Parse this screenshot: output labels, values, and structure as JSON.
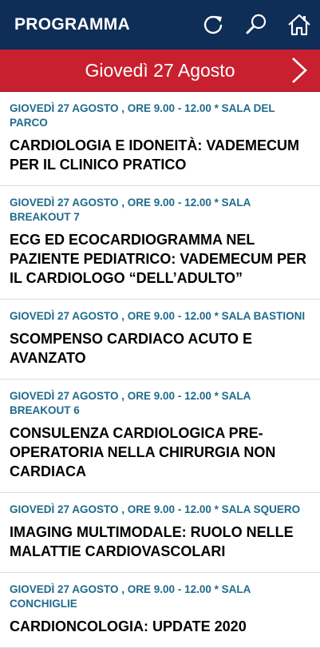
{
  "header": {
    "title": "PROGRAMMA",
    "icons": [
      "refresh-icon",
      "search-icon",
      "home-icon"
    ]
  },
  "datebar": {
    "label": "Giovedì 27 Agosto"
  },
  "colors": {
    "header_bg": "#0e2d57",
    "datebar_bg": "#c8202f",
    "meta_text": "#1e6a8d"
  },
  "sessions": [
    {
      "meta": "GIOVEDÌ 27 AGOSTO , ORE 9.00 - 12.00 * SALA DEL PARCO",
      "title": "CARDIOLOGIA E IDONEITÀ: VADEMECUM PER IL CLINICO PRATICO"
    },
    {
      "meta": "GIOVEDÌ 27 AGOSTO , ORE 9.00 - 12.00 * SALA BREAKOUT 7",
      "title": "ECG ED ECOCARDIOGRAMMA NEL PAZIENTE PEDIATRICO: VADEMECUM PER IL CARDIOLOGO “DELL’ADULTO”"
    },
    {
      "meta": "GIOVEDÌ 27 AGOSTO , ORE 9.00 - 12.00 * SALA BASTIONI",
      "title": "SCOMPENSO CARDIACO ACUTO E AVANZATO"
    },
    {
      "meta": "GIOVEDÌ 27 AGOSTO , ORE 9.00 - 12.00 * SALA BREAKOUT 6",
      "title": "CONSULENZA CARDIOLOGICA PRE-OPERATORIA NELLA CHIRURGIA NON CARDIACA"
    },
    {
      "meta": "GIOVEDÌ 27 AGOSTO , ORE 9.00 - 12.00 * SALA SQUERO",
      "title": "IMAGING MULTIMODALE: RUOLO NELLE MALATTIE CARDIOVASCOLARI"
    },
    {
      "meta": "GIOVEDÌ 27 AGOSTO , ORE 9.00 - 12.00 * SALA CONCHIGLIE",
      "title": "CARDIONCOLOGIA: UPDATE 2020"
    }
  ]
}
